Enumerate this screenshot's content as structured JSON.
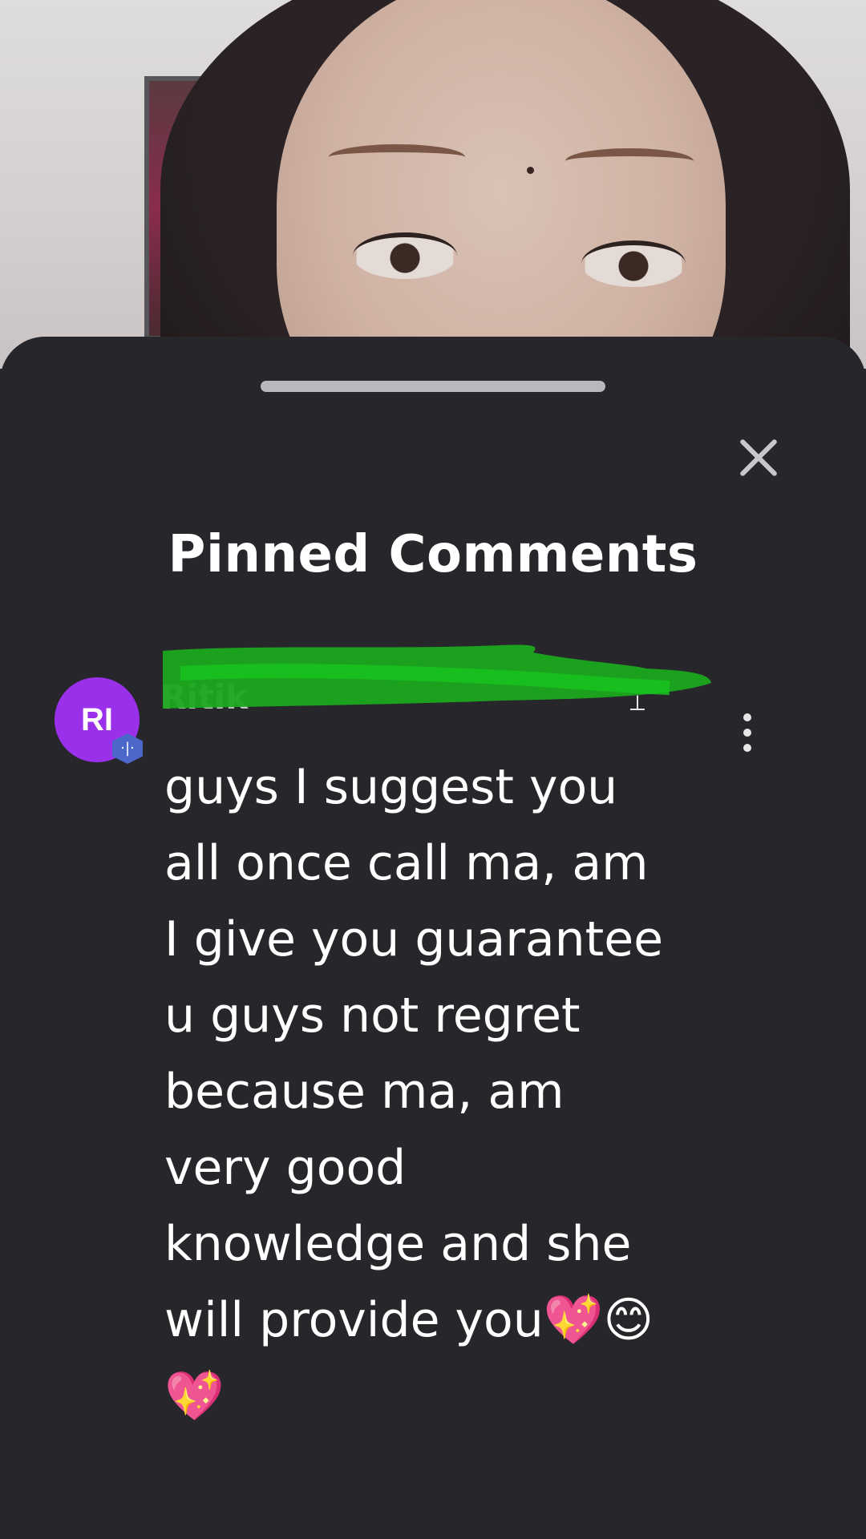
{
  "sheet": {
    "title": "Pinned Comments",
    "close_icon": "close-icon"
  },
  "comment": {
    "avatar_initials": "RI",
    "author_name": "Ritik",
    "text": "guys I suggest you all once call ma, am I give you guarantee u guys not regret because ma, am very good knowledge and she will provide you💖😊💖",
    "pin_icon": "pin-icon",
    "more_icon": "more-vertical-icon",
    "badge_icon": "verified-badge-icon"
  },
  "colors": {
    "sheet_background": "#26262b",
    "avatar": "#9b30ea",
    "badge": "#4a67c9",
    "redaction": "#1ba81f"
  }
}
